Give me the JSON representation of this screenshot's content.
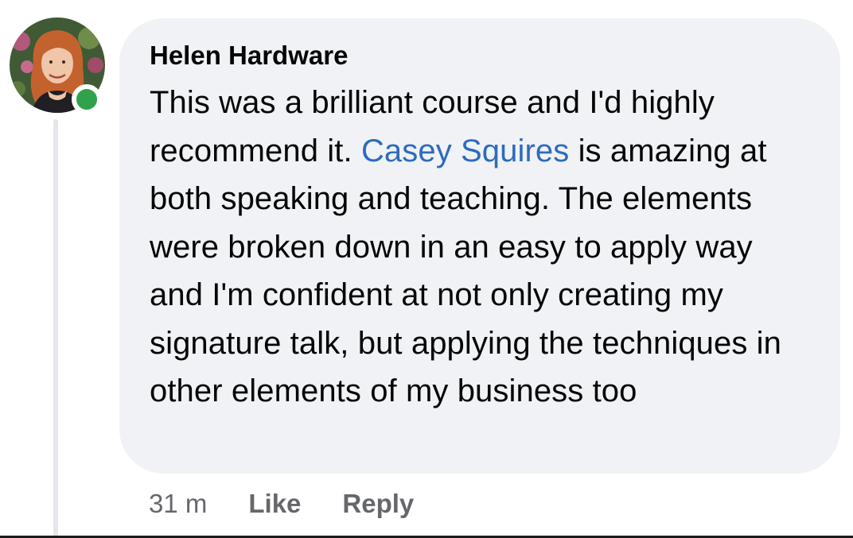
{
  "comment": {
    "author": "Helen Hardware",
    "text_before_mention": "This was a brilliant course and I'd highly recommend it. ",
    "mention": "Casey Squires",
    "text_after_mention": " is amazing at both speaking and teaching. The elements were broken down in an easy to apply way and I'm confident at not only creating my signature talk, but applying the techniques in other elements of my business too",
    "online": true
  },
  "actions": {
    "time": "31 m",
    "like_label": "Like",
    "reply_label": "Reply"
  },
  "colors": {
    "bubble": "#f0f2f5",
    "mention": "#2d6bbd",
    "online": "#31a24c",
    "meta": "#65676b"
  }
}
